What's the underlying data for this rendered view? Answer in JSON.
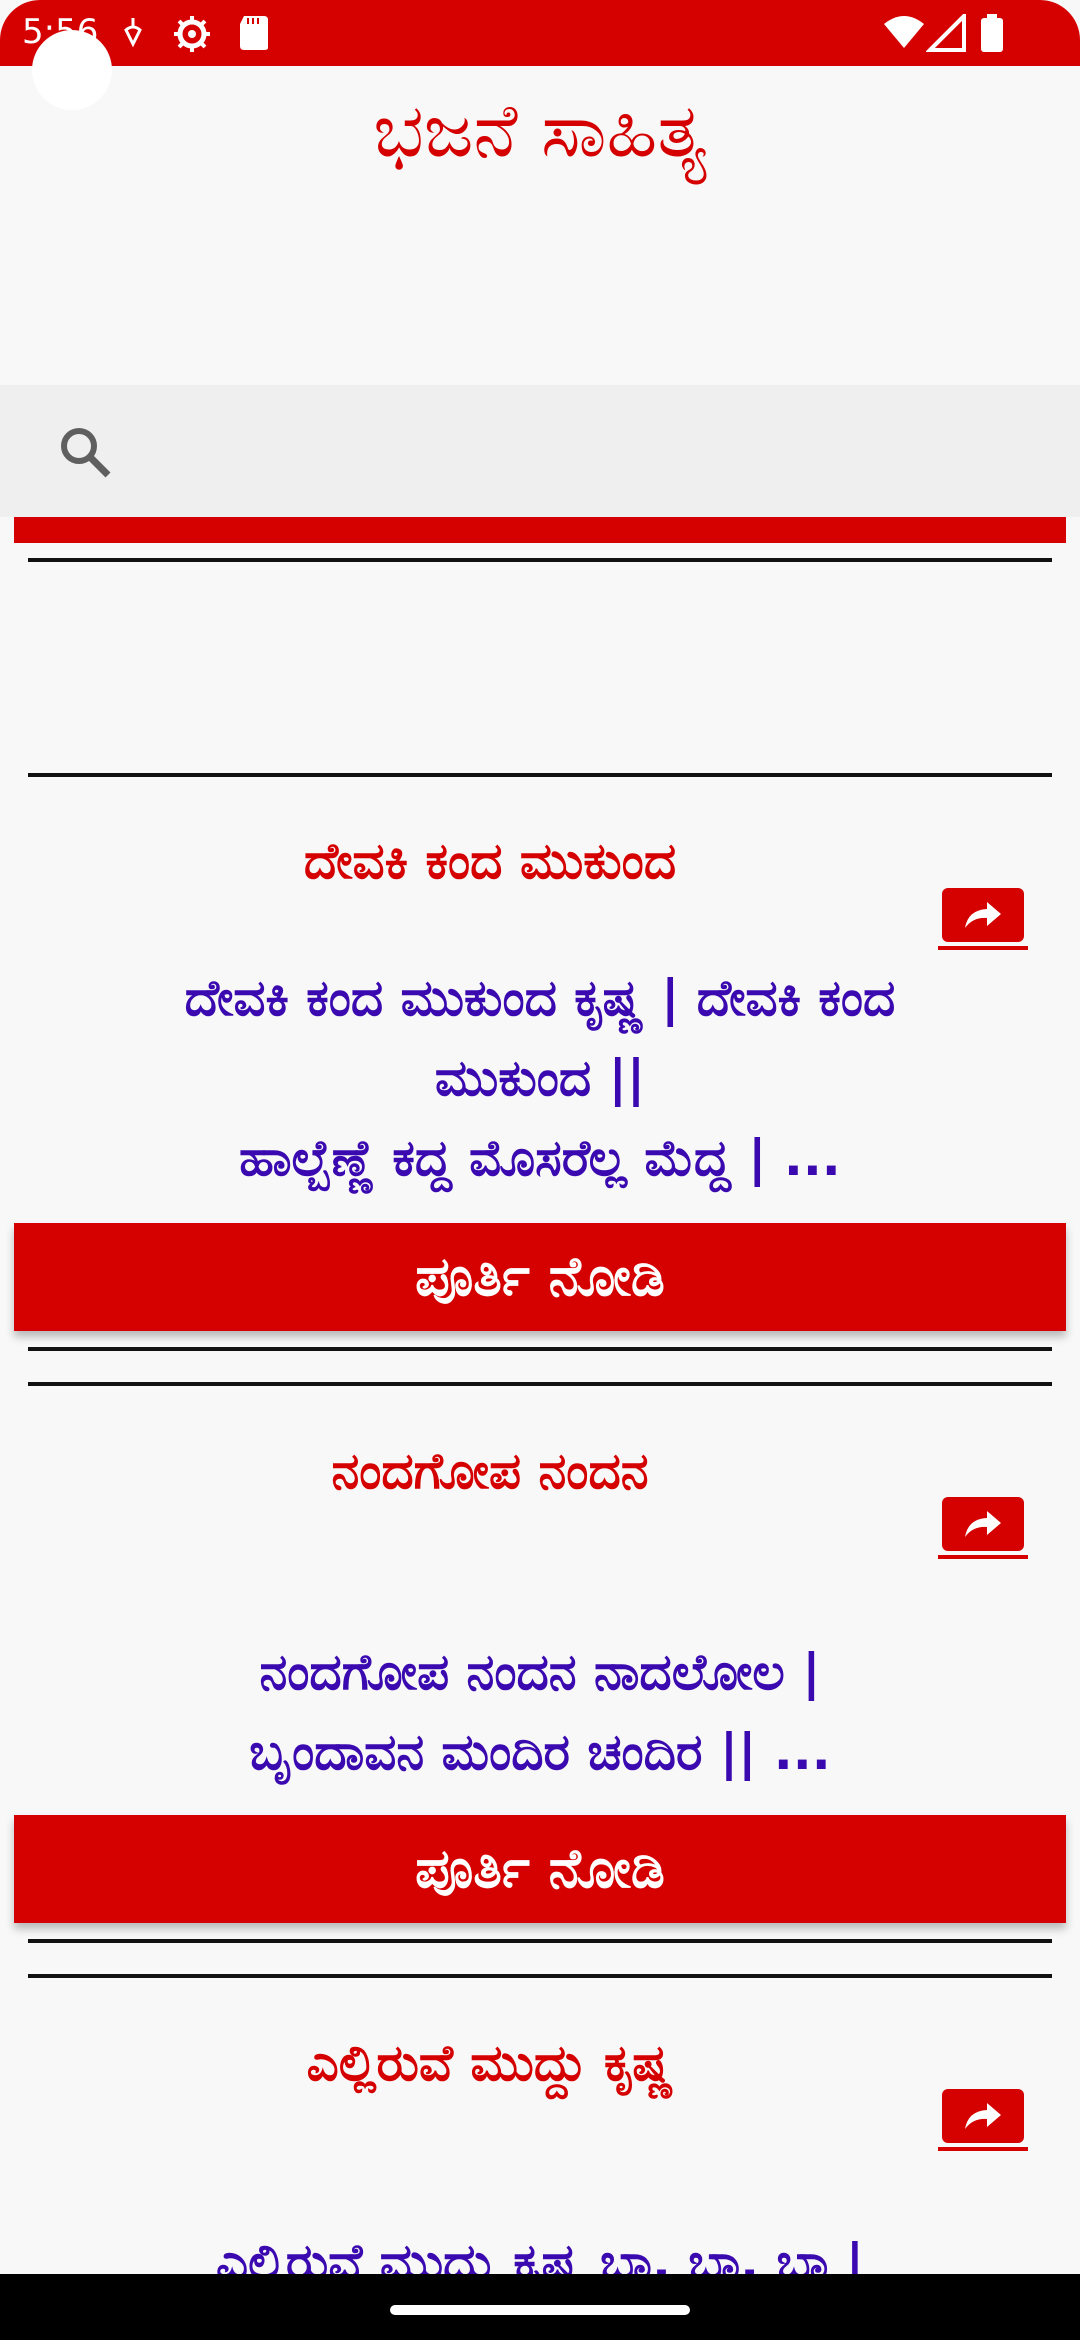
{
  "status_bar": {
    "time": "5:56"
  },
  "app": {
    "title": "ಭಜನೆ ಸಾಹಿತ್ಯ"
  },
  "search": {
    "placeholder": ""
  },
  "cards": [
    {
      "title": "ದೇವಕಿ ಕಂದ ಮುಕುಂದ",
      "lines": [
        "ದೇವಕಿ ಕಂದ ಮುಕುಂದ ಕೃಷ್ಣ | ದೇವಕಿ ಕಂದ",
        "ಮುಕುಂದ ||",
        "ಹಾಲ್ಬೆಣ್ಣೆ ಕದ್ದ ಮೊಸರೆಲ್ಲ ಮೆದ್ದ | ..."
      ],
      "button_label": "ಪೂರ್ತಿ ನೋಡಿ"
    },
    {
      "title": "ನಂದಗೋಪ ನಂದನ",
      "lines": [
        "ನಂದಗೋಪ ನಂದನ ನಾದಲೋಲ |",
        "ಬೃಂದಾವನ ಮಂದಿರ ಚಂದಿರ || ..."
      ],
      "button_label": "ಪೂರ್ತಿ ನೋಡಿ"
    },
    {
      "title": "ಎಲ್ಲಿರುವೆ ಮುದ್ದು ಕೃಷ್ಣ",
      "lines": [
        "ಎಲ್ಲಿರುವೆ ಮುದ್ದು ಕೃಷ್ಣ ಬಾ, ಬಾ, ಬಾ |"
      ]
    }
  ],
  "colors": {
    "accent": "#d50000",
    "body_text": "#3a0ab0"
  }
}
